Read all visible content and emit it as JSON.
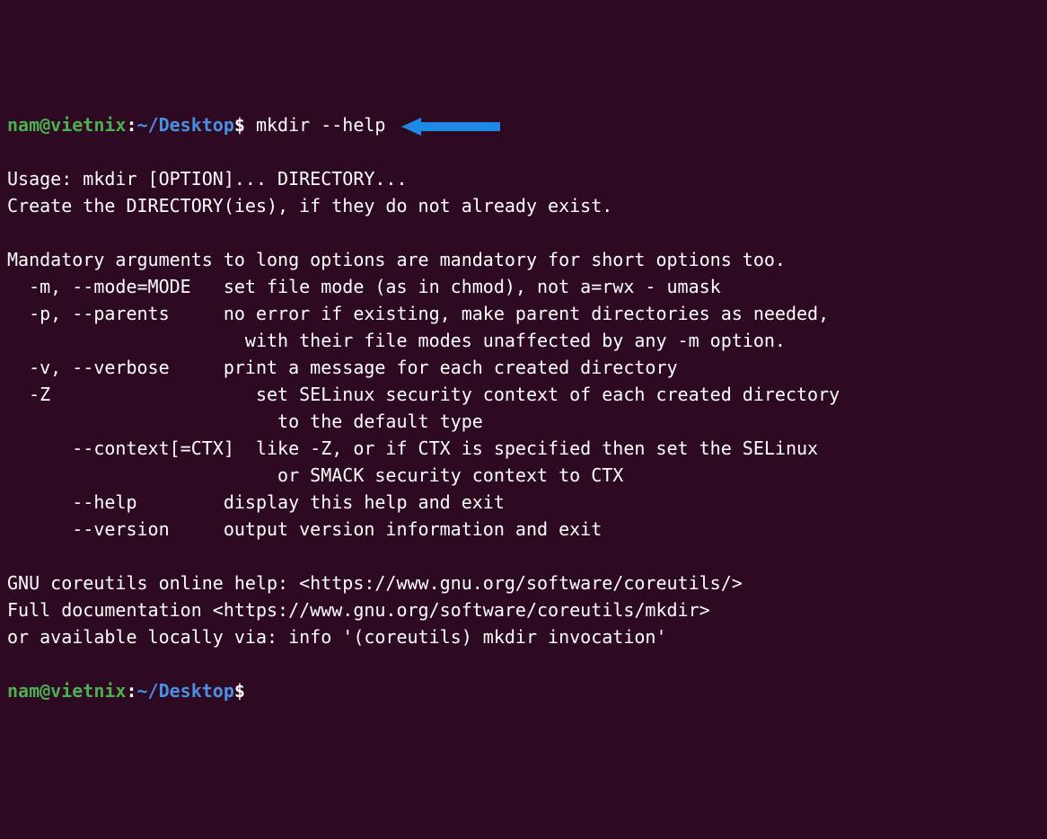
{
  "prompt1": {
    "user": "nam@vietnix",
    "colon": ":",
    "path": "~/Desktop",
    "dollar": "$",
    "command": " mkdir --help"
  },
  "output_lines": [
    "Usage: mkdir [OPTION]... DIRECTORY...",
    "Create the DIRECTORY(ies), if they do not already exist.",
    "",
    "Mandatory arguments to long options are mandatory for short options too.",
    "  -m, --mode=MODE   set file mode (as in chmod), not a=rwx - umask",
    "  -p, --parents     no error if existing, make parent directories as needed,",
    "                      with their file modes unaffected by any -m option.",
    "  -v, --verbose     print a message for each created directory",
    "  -Z                   set SELinux security context of each created directory",
    "                         to the default type",
    "      --context[=CTX]  like -Z, or if CTX is specified then set the SELinux",
    "                         or SMACK security context to CTX",
    "      --help        display this help and exit",
    "      --version     output version information and exit",
    "",
    "GNU coreutils online help: <https://www.gnu.org/software/coreutils/>",
    "Full documentation <https://www.gnu.org/software/coreutils/mkdir>",
    "or available locally via: info '(coreutils) mkdir invocation'"
  ],
  "prompt2": {
    "user": "nam@vietnix",
    "colon": ":",
    "path": "~/Desktop",
    "dollar": "$"
  }
}
